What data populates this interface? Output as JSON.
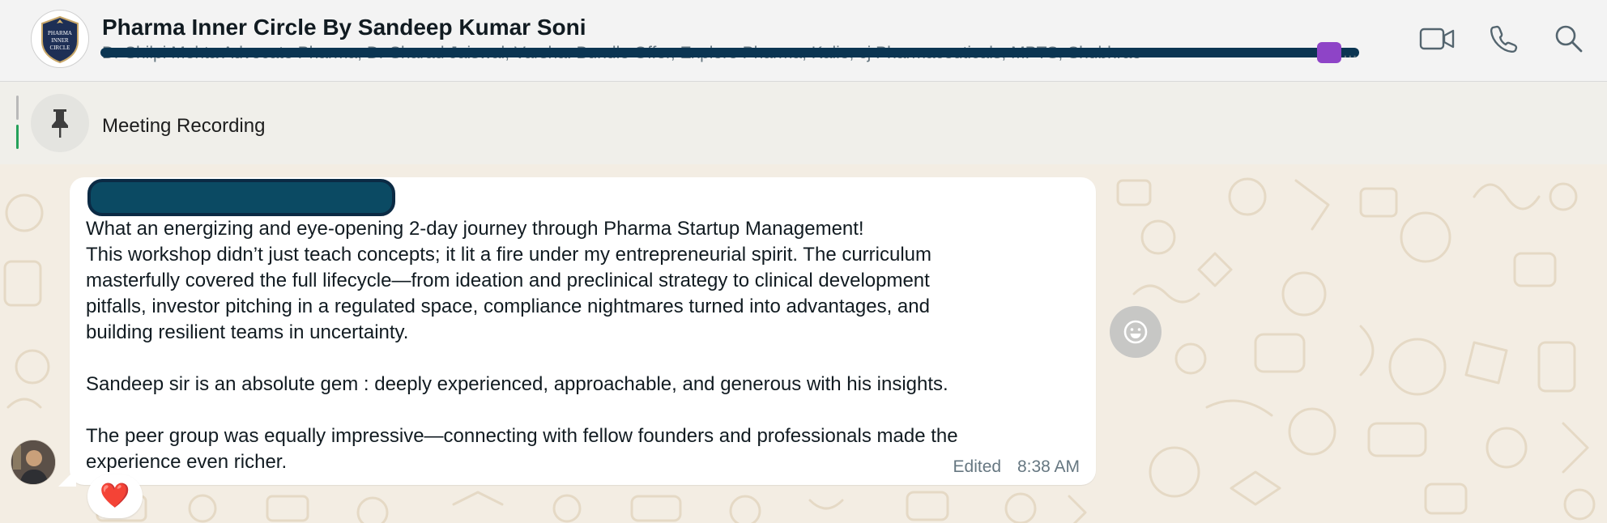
{
  "header": {
    "group_name": "Pharma Inner Circle By Sandeep Kumar Soni",
    "members_preview": "Dr Shilpi Mehta Advocate Pharma, Dr Sharad Jaiswal, Varsha: Bundle Offer, Explore Pharma, Kalio, cj Pharmaceuticals, MPTS, Shubhrao",
    "members_ellipsis": "...",
    "avatar_lines": [
      "PHARMA",
      "INNER",
      "CIRCLE"
    ],
    "actions": {
      "video": "video-camera-icon",
      "call": "phone-icon",
      "search": "search-icon"
    }
  },
  "pinned": {
    "label": "Meeting Recording",
    "icon": "pin-icon"
  },
  "message": {
    "lines_p1": [
      "What an energizing and eye-opening 2-day journey through Pharma Startup Management!",
      "This workshop didn’t just teach concepts; it lit a fire under my entrepreneurial spirit. The curriculum",
      "masterfully covered the full lifecycle—from ideation and preclinical strategy to clinical development",
      "pitfalls, investor pitching in a regulated space, compliance nightmares turned into advantages, and",
      "building resilient teams in uncertainty."
    ],
    "line_p2": "Sandeep sir is an absolute gem : deeply experienced, approachable, and generous with his insights.",
    "lines_p3": [
      "The peer group was equally impressive—connecting with fellow founders and professionals made the",
      "experience even richer."
    ],
    "edited_label": "Edited",
    "time": "8:38 AM",
    "reaction": "❤️"
  },
  "colors": {
    "header_bg": "#f3f3f3",
    "chat_bg": "#f3ede3",
    "bubble_bg": "#ffffff",
    "redaction": "#0b4a63",
    "accent_green": "#25a15a",
    "member_badge": "#8e44c7"
  }
}
